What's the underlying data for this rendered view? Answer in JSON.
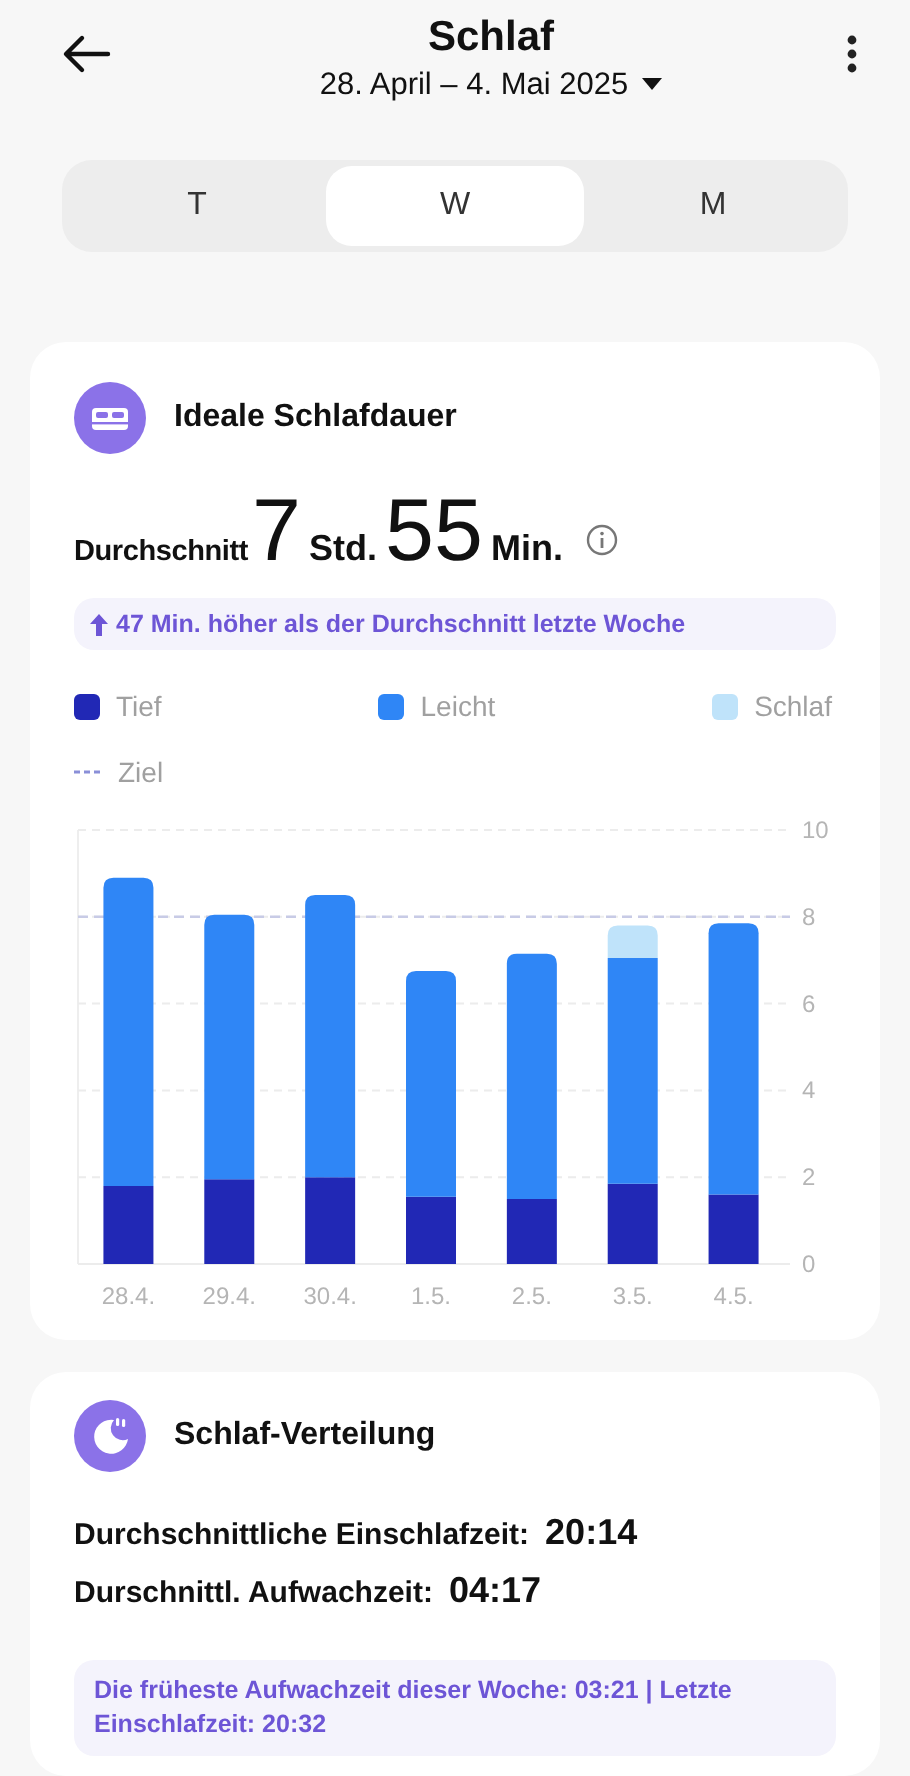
{
  "header": {
    "title": "Schlaf",
    "date_range": "28. April – 4. Mai 2025"
  },
  "tabs": [
    {
      "label": "T",
      "selected": false
    },
    {
      "label": "W",
      "selected": true
    },
    {
      "label": "M",
      "selected": false
    }
  ],
  "duration_card": {
    "title": "Ideale Schlafdauer",
    "average_label": "Durchschnitt",
    "hours": "7",
    "hours_unit": "Std.",
    "minutes": "55",
    "minutes_unit": "Min.",
    "comparison": "47 Min. höher als der Durchschnitt letzte Woche",
    "chart_data": {
      "type": "bar",
      "stacked": true,
      "categories": [
        "28.4.",
        "29.4.",
        "30.4.",
        "1.5.",
        "2.5.",
        "3.5.",
        "4.5."
      ],
      "series": [
        {
          "name": "Tief",
          "color": "#2128b5",
          "values": [
            1.8,
            1.95,
            2.0,
            1.55,
            1.5,
            1.85,
            1.6
          ]
        },
        {
          "name": "Leicht",
          "color": "#2f86f6",
          "values": [
            7.1,
            6.1,
            6.5,
            5.2,
            5.65,
            5.2,
            6.25
          ]
        },
        {
          "name": "Schlaf",
          "color": "#bfe3fa",
          "values": [
            0,
            0,
            0,
            0,
            0,
            0.75,
            0
          ]
        }
      ],
      "ylim": [
        0,
        10
      ],
      "yticks": [
        0,
        2,
        4,
        6,
        8,
        10
      ],
      "grid": true,
      "ref_lines": [
        {
          "axis": "y",
          "value": 8,
          "label": "Ziel"
        }
      ]
    }
  },
  "distribution_card": {
    "title": "Schlaf-Verteilung",
    "rows": [
      {
        "label": "Durchschnittliche Einschlafzeit:",
        "value": "20:14"
      },
      {
        "label": "Durschnittl. Aufwachzeit:",
        "value": "04:17"
      }
    ],
    "note": "Die früheste Aufwachzeit dieser Woche: 03:21 | Letzte Einschlafzeit: 20:32"
  }
}
